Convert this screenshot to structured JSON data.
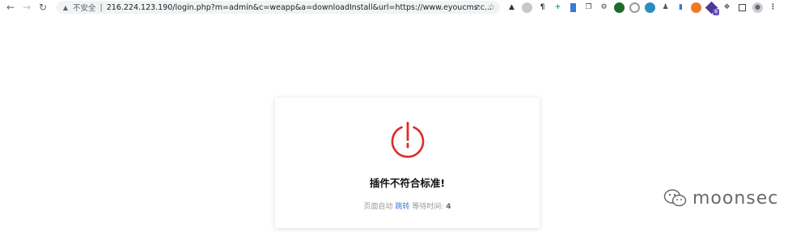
{
  "browser": {
    "security_label": "不安全",
    "separator": "|",
    "url": "216.224.123.190/login.php?m=admin&c=weapp&a=downloadInstall&url=https://www.eyoucms.c...",
    "extensions": [
      "hat-icon",
      "circle-grey-icon",
      "paragraph-icon",
      "plus-icon",
      "bookmark-icon",
      "copy-icon",
      "settings-icon",
      "green-dot-icon",
      "ring-icon",
      "edge-icon",
      "user-icon",
      "chart-icon",
      "firefox-icon",
      "badge-ext-icon",
      "puzzle-icon",
      "sidebar-icon",
      "profile-icon",
      "menu-icon"
    ],
    "extension_badge": "8"
  },
  "dialog": {
    "accent_color": "#e02a2a",
    "message": "插件不符合标准!",
    "redirect_prefix": "页面自动",
    "redirect_link": "跳转",
    "redirect_suffix": "等待时间:",
    "countdown": "4"
  },
  "watermark": {
    "text": "moonsec"
  }
}
